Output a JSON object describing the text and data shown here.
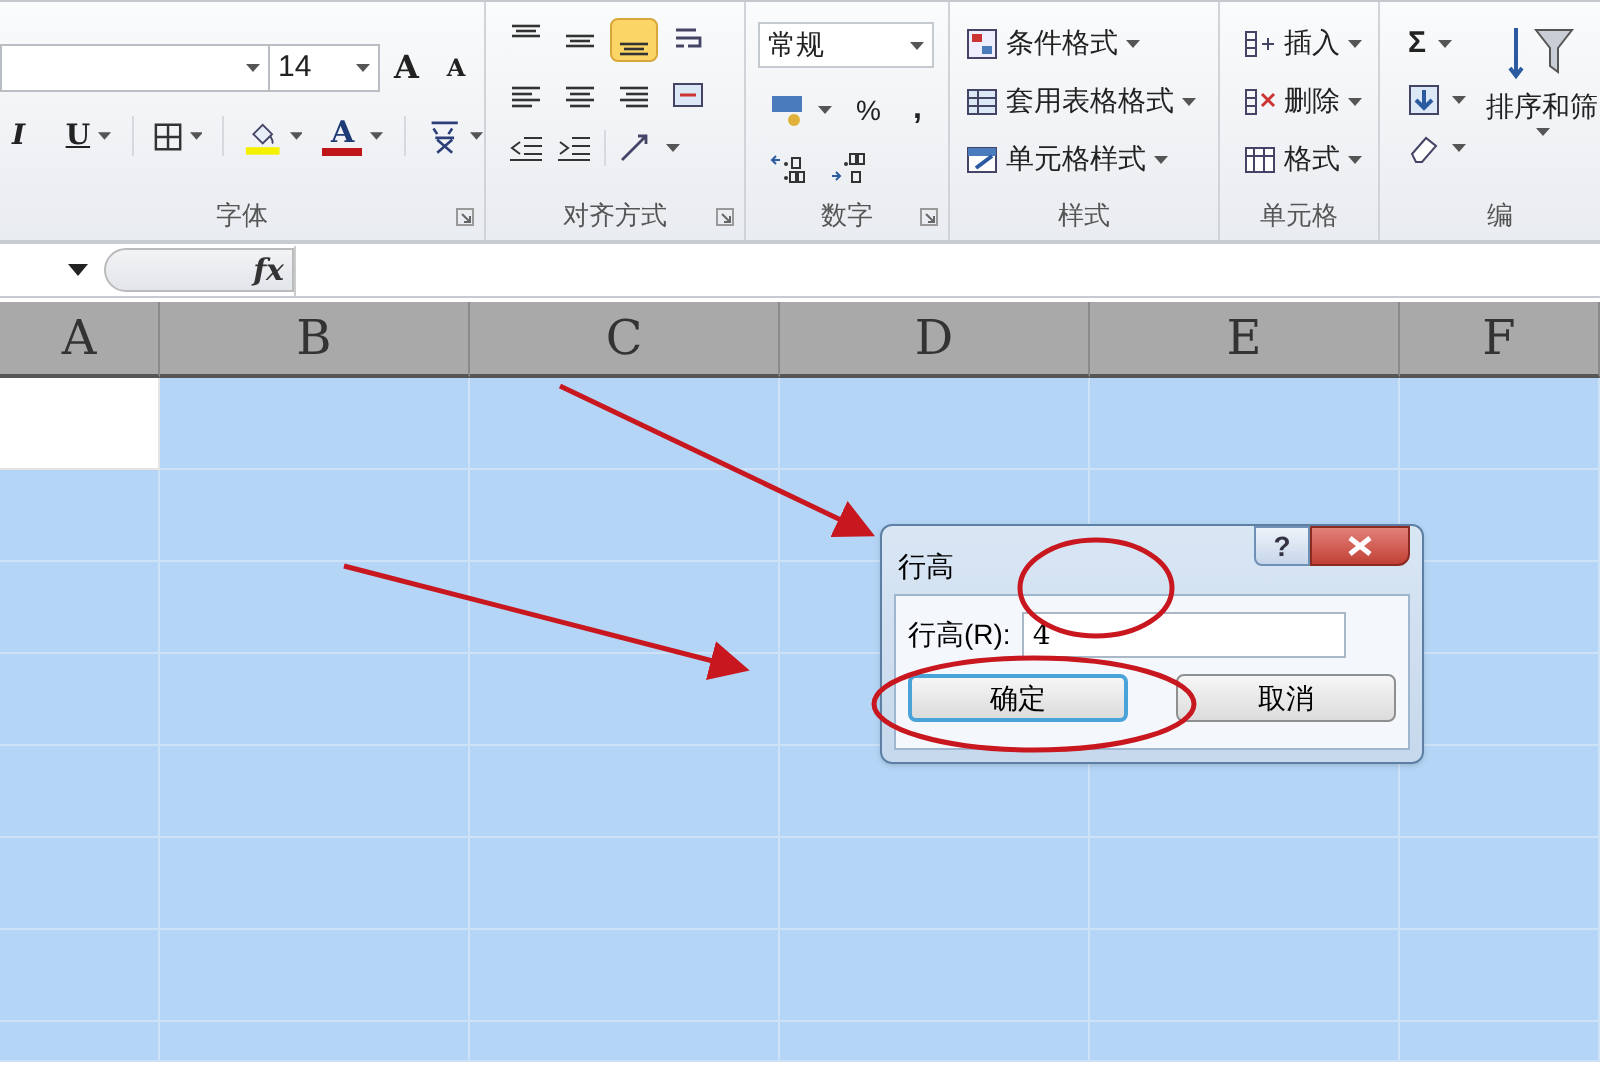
{
  "ribbon": {
    "font": {
      "label": "字体",
      "size": "14",
      "grow": "A",
      "shrink": "A",
      "italic": "I",
      "underline": "U",
      "font_color": "A"
    },
    "alignment": {
      "label": "对齐方式",
      "buttons": [
        {
          "kind": "align-top",
          "selected": false
        },
        {
          "kind": "align-middle",
          "selected": false
        },
        {
          "kind": "align-bottom",
          "selected": true
        },
        {
          "kind": "wrap",
          "selected": false
        },
        {
          "kind": "align-left",
          "selected": false
        },
        {
          "kind": "align-center",
          "selected": false
        },
        {
          "kind": "align-right",
          "selected": false
        },
        {
          "kind": "merge",
          "selected": false
        }
      ]
    },
    "number": {
      "label": "数字",
      "format": "常规",
      "percent": "%",
      "comma": ","
    },
    "styles": {
      "label": "样式",
      "items": [
        {
          "kind": "conditional",
          "label": "条件格式"
        },
        {
          "kind": "table",
          "label": "套用表格格式"
        },
        {
          "kind": "cell",
          "label": "单元格样式"
        }
      ]
    },
    "cells": {
      "label": "单元格",
      "items": [
        {
          "kind": "insert",
          "label": "插入"
        },
        {
          "kind": "delete",
          "label": "删除"
        },
        {
          "kind": "format",
          "label": "格式"
        }
      ]
    },
    "editing": {
      "label": "编",
      "sum": "Σ",
      "sort": "排序和筛"
    }
  },
  "formula_bar": {
    "fx": "fx"
  },
  "columns": [
    "A",
    "B",
    "C",
    "D",
    "E",
    "F"
  ],
  "rows": [
    {
      "selected": true,
      "active": true
    },
    {
      "selected": true,
      "active": false
    },
    {
      "selected": true,
      "active": false
    },
    {
      "selected": true,
      "active": false
    },
    {
      "selected": true,
      "active": false
    },
    {
      "selected": true,
      "active": false
    },
    {
      "selected": true,
      "active": false
    },
    {
      "selected": true,
      "active": false
    }
  ],
  "dialog": {
    "title": "行高",
    "help": "?",
    "field_label": "行高(R):",
    "value": "4",
    "buttons": [
      {
        "label": "确定",
        "selected": true
      },
      {
        "label": "取消",
        "selected": false
      }
    ]
  }
}
